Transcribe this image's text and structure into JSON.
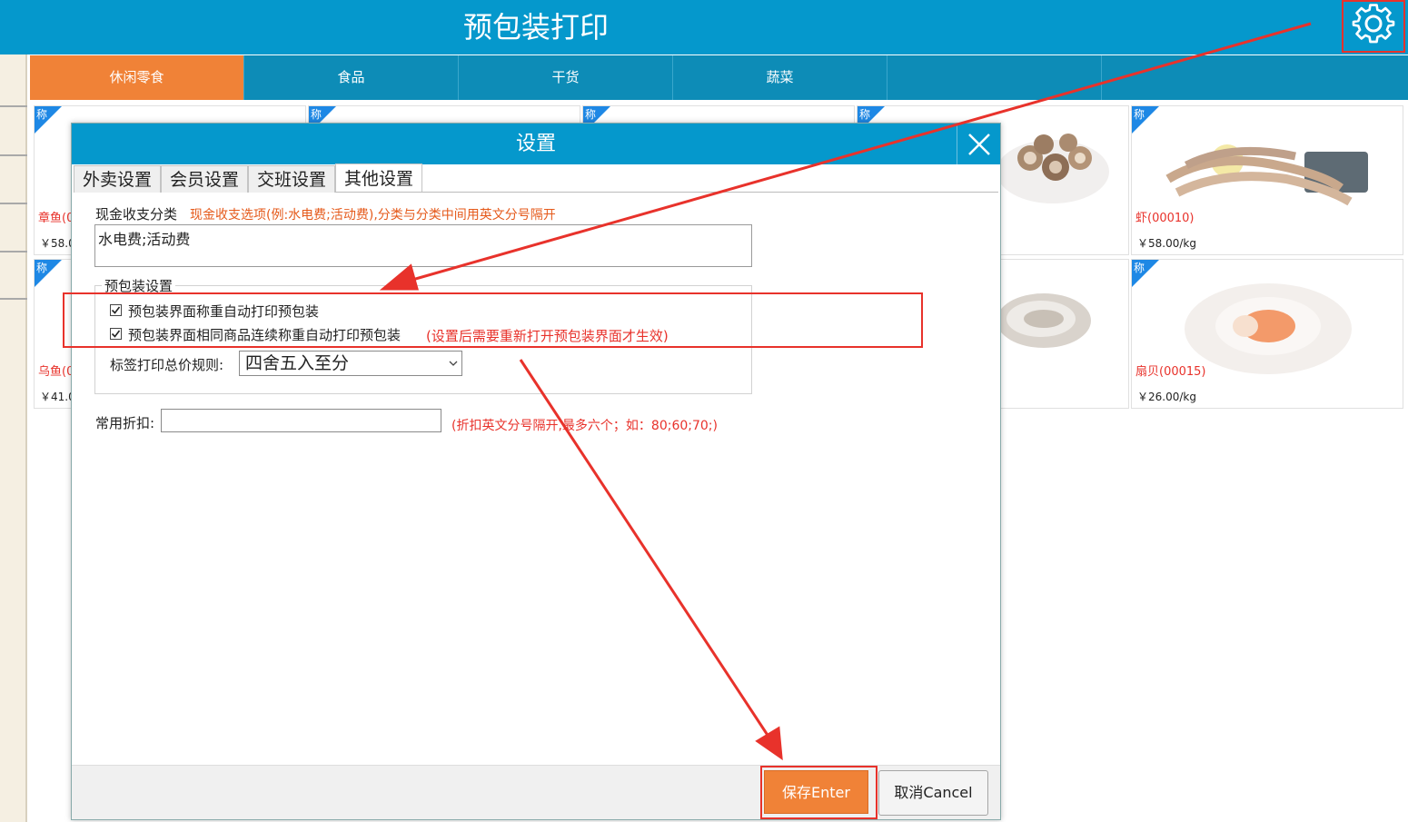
{
  "window": {
    "title": "预包装打印",
    "gear_icon": "gear-icon"
  },
  "category_tabs": [
    "休闲零食",
    "食品",
    "干货",
    "蔬菜",
    "",
    ""
  ],
  "product_badge": "称",
  "products": [
    {
      "name": "章鱼(0",
      "price": "￥58.0",
      "image": "octopus"
    },
    {
      "name": "",
      "price": "",
      "image": "squid"
    },
    {
      "name": "",
      "price": "",
      "image": "fish"
    },
    {
      "name": "",
      "price": "",
      "image": "snails"
    },
    {
      "name": "虾(00010)",
      "price": "￥58.00/kg",
      "image": "shrimp"
    },
    {
      "name": "乌鱼(0",
      "price": "￥41.0",
      "image": "cuttlefish"
    },
    {
      "name": "",
      "price": "",
      "image": "blank"
    },
    {
      "name": "",
      "price": "",
      "image": "blank"
    },
    {
      "name": "",
      "price": "",
      "image": "oyster"
    },
    {
      "name": "扇贝(00015)",
      "price": "￥26.00/kg",
      "image": "scallop"
    }
  ],
  "dialog": {
    "title": "设置",
    "tabs": [
      "外卖设置",
      "会员设置",
      "交班设置",
      "其他设置"
    ],
    "active_tab": "其他设置",
    "cash_category_label": "现金收支分类",
    "cash_category_hint": "现金收支选项(例:水电费;活动费),分类与分类中间用英文分号隔开",
    "cash_category_value": "水电费;活动费",
    "prepack_group_title": "预包装设置",
    "checkbox1_label": "预包装界面称重自动打印预包装",
    "checkbox1_checked": true,
    "checkbox2_label": "预包装界面相同商品连续称重自动打印预包装",
    "checkbox2_checked": true,
    "checkbox2_hint": "(设置后需要重新打开预包装界面才生效)",
    "rounding_label": "标签打印总价规则:",
    "rounding_value": "四舍五入至分",
    "discount_label": "常用折扣:",
    "discount_value": "",
    "discount_hint": "(折扣英文分号隔开,最多六个；如：80;60;70;)",
    "save_button": "保存Enter",
    "cancel_button": "取消Cancel"
  },
  "colors": {
    "header_blue": "#0598cc",
    "tab_blue": "#0d8cb7",
    "accent_orange": "#f08237",
    "annotation_red": "#e8322b"
  }
}
